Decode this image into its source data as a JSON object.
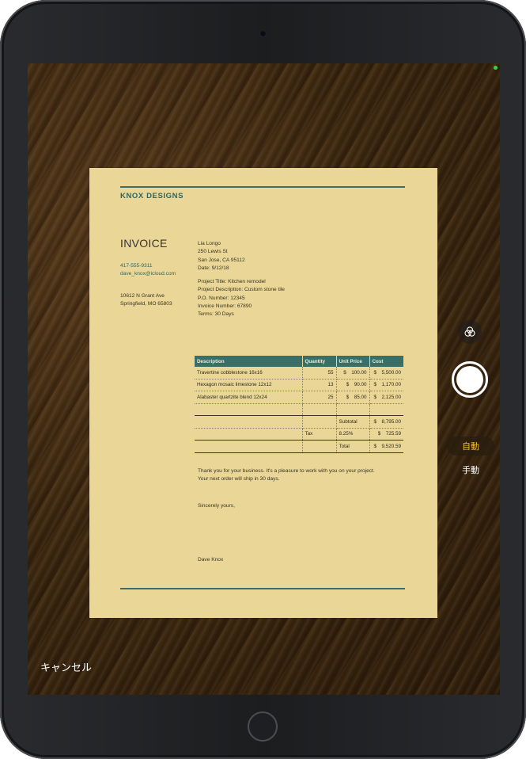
{
  "camera_ui": {
    "cancel_label": "キャンセル",
    "mode_auto_label": "自動",
    "mode_manual_label": "手動",
    "filter_icon": "filters-icon",
    "shutter_icon": "shutter-button"
  },
  "invoice": {
    "company": "KNOX DESIGNS",
    "title": "INVOICE",
    "phone": "417-555-9311",
    "email": "dave_knox@icloud.com",
    "address_line1": "10612 N Grant Ave",
    "address_line2": "Springfield, MO 65803",
    "client_name": "Lia Longo",
    "client_street": "250 Lewis St",
    "client_city": "San Jose, CA 95112",
    "date": "Date: 9/12/18",
    "project_title": "Project Title: Kitchen remodel",
    "project_description": "Project Description: Custom stone tile",
    "po_number": "P.O. Number: 12345",
    "invoice_number": "Invoice Number: 67890",
    "terms": "Terms: 30 Days",
    "table_headers": {
      "description": "Description",
      "quantity": "Quantity",
      "unit_price": "Unit Price",
      "cost": "Cost"
    },
    "items": [
      {
        "description": "Travertine cobblestone 16x16",
        "quantity": "55",
        "unit_price": "100.00",
        "cost": "5,500.00"
      },
      {
        "description": "Hexagon mosaic limestone 12x12",
        "quantity": "13",
        "unit_price": "90.00",
        "cost": "1,170.00"
      },
      {
        "description": "Alabaster quartzite blend 12x24",
        "quantity": "25",
        "unit_price": "85.00",
        "cost": "2,125.00"
      }
    ],
    "currency_symbol": "$",
    "subtotal_label": "Subtotal",
    "subtotal_value": "8,795.00",
    "tax_label": "Tax",
    "tax_rate": "8.25%",
    "tax_value": "725.59",
    "total_label": "Total",
    "total_value": "9,520.59",
    "thanks_line1": "Thank you for your business. It's a pleasure to work with you on your project.",
    "thanks_line2": "Your next order will ship in 30 days.",
    "closing": "Sincerely yours,",
    "signer": "Dave Knox"
  }
}
